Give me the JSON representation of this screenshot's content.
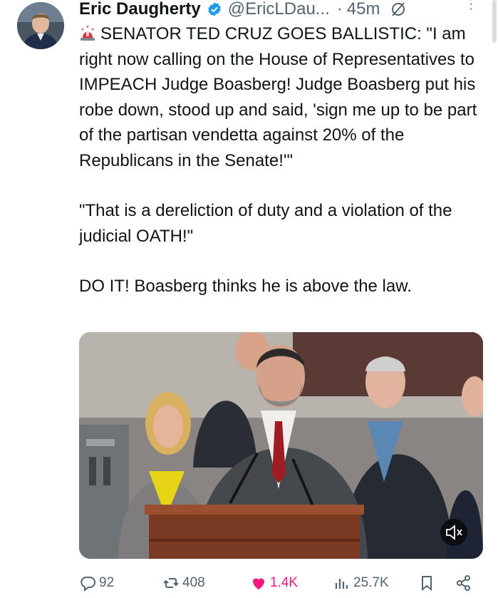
{
  "author": {
    "name": "Eric Daugherty",
    "handle": "@EricLDau...",
    "separator": "·",
    "time": "45m"
  },
  "tweet": {
    "paragraphs": [
      "SENATOR TED CRUZ GOES BALLISTIC: \"I am right now calling on the House of Representatives to IMPEACH Judge Boasberg! Judge Boasberg put his robe down, stood up and said, 'sign me up to be part of the partisan vendetta against 20% of the Republicans in the Senate!'\"",
      "\"That is a dereliction of duty and a violation of the judicial OATH!\"",
      "DO IT! Boasberg thinks he is above the law."
    ]
  },
  "media": {
    "type": "video",
    "muted": true
  },
  "actions": {
    "replies": "92",
    "reposts": "408",
    "likes": "1.4K",
    "views": "25.7K"
  },
  "colors": {
    "text": "#0f1419",
    "secondary": "#536471",
    "verified": "#1d9bf0",
    "like": "#f91880"
  }
}
